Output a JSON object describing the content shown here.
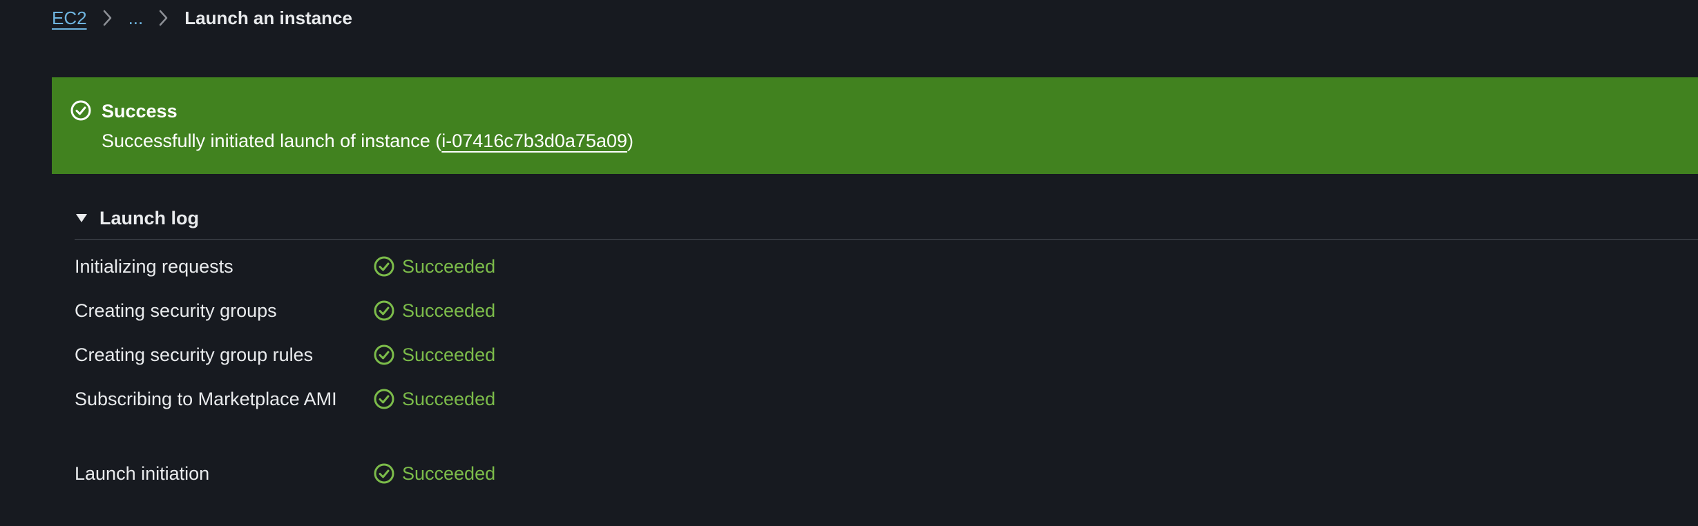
{
  "breadcrumb": {
    "root": "EC2",
    "ellipsis": "...",
    "current": "Launch an instance"
  },
  "flash": {
    "type": "success",
    "icon": "check-circle-icon",
    "title": "Success",
    "message_prefix": "Successfully initiated launch of instance (",
    "instance_id": "i-07416c7b3d0a75a09",
    "message_suffix": ")",
    "color": "#41821f"
  },
  "launch_log": {
    "title": "Launch log",
    "expanded": true,
    "steps": [
      {
        "label": "Initializing requests",
        "status": "Succeeded"
      },
      {
        "label": "Creating security groups",
        "status": "Succeeded"
      },
      {
        "label": "Creating security group rules",
        "status": "Succeeded"
      },
      {
        "label": "Subscribing to Marketplace AMI",
        "status": "Succeeded"
      },
      {
        "label": "Launch initiation",
        "status": "Succeeded"
      }
    ],
    "status_color": "#7cbc4a"
  }
}
